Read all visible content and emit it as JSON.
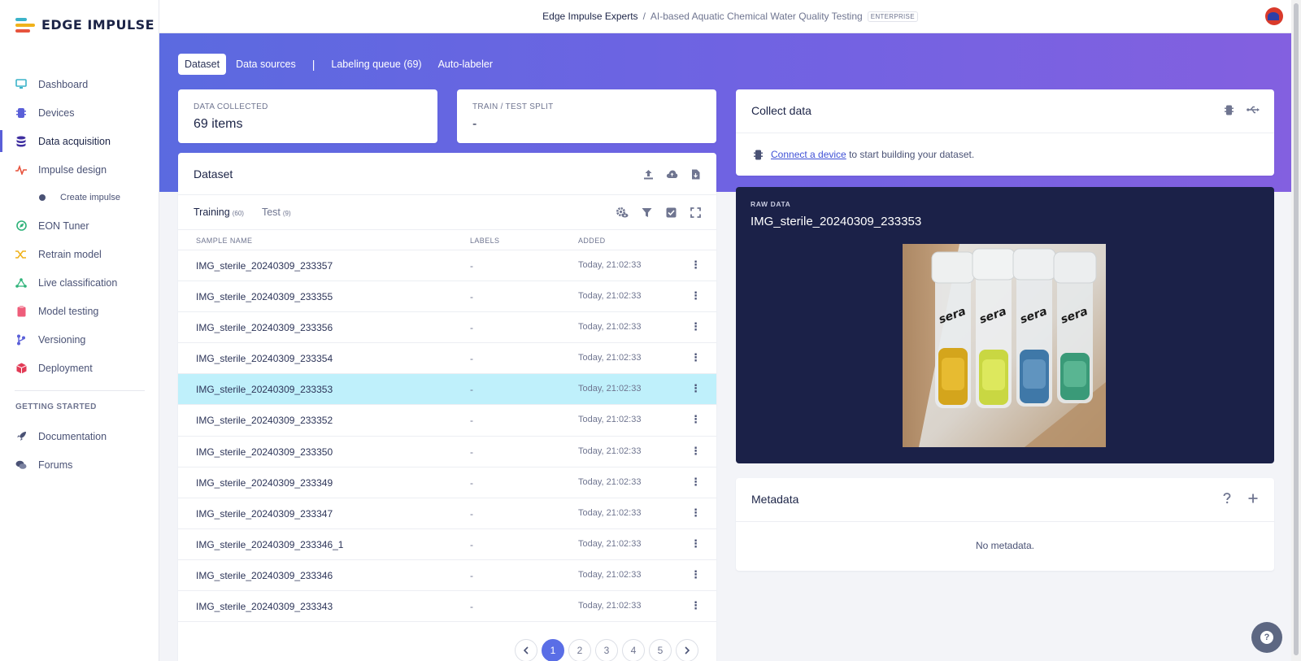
{
  "app": {
    "logo_text": "EDGE IMPULSE"
  },
  "header": {
    "org": "Edge Impulse Experts",
    "separator": "/",
    "project": "AI-based Aquatic Chemical Water Quality Testing",
    "badge": "ENTERPRISE"
  },
  "sidebar": {
    "items": [
      {
        "label": "Dashboard",
        "icon": "monitor-icon",
        "color": "#3bb3c9"
      },
      {
        "label": "Devices",
        "icon": "chip-icon",
        "color": "#5a5fd8"
      },
      {
        "label": "Data acquisition",
        "icon": "database-icon",
        "color": "#3f2fa0"
      },
      {
        "label": "Impulse design",
        "icon": "pulse-icon",
        "color": "#e7533d"
      },
      {
        "label": "Create impulse",
        "icon": "dot-icon",
        "color": "#4a5275"
      },
      {
        "label": "EON Tuner",
        "icon": "compass-icon",
        "color": "#2fb37a"
      },
      {
        "label": "Retrain model",
        "icon": "shuffle-icon",
        "color": "#f0b21b"
      },
      {
        "label": "Live classification",
        "icon": "network-icon",
        "color": "#2fb37a"
      },
      {
        "label": "Model testing",
        "icon": "clipboard-icon",
        "color": "#ee5d7a"
      },
      {
        "label": "Versioning",
        "icon": "branch-icon",
        "color": "#5a5fd8"
      },
      {
        "label": "Deployment",
        "icon": "cube-icon",
        "color": "#e23b56"
      }
    ],
    "getting_started_heading": "GETTING STARTED",
    "help_items": [
      {
        "label": "Documentation",
        "icon": "rocket-icon"
      },
      {
        "label": "Forums",
        "icon": "chat-icon"
      }
    ]
  },
  "tabs": {
    "dataset": "Dataset",
    "data_sources": "Data sources",
    "separator": "|",
    "labeling_queue": "Labeling queue (69)",
    "auto_labeler": "Auto-labeler"
  },
  "stats": {
    "collected_label": "DATA COLLECTED",
    "collected_value": "69 items",
    "split_label": "TRAIN / TEST SPLIT",
    "split_value": "-"
  },
  "dataset": {
    "title": "Dataset",
    "training_label": "Training",
    "training_count": "(60)",
    "test_label": "Test",
    "test_count": "(9)",
    "columns": [
      "SAMPLE NAME",
      "LABELS",
      "ADDED"
    ],
    "rows": [
      {
        "name": "IMG_sterile_20240309_233357",
        "label": "-",
        "added": "Today, 21:02:33"
      },
      {
        "name": "IMG_sterile_20240309_233355",
        "label": "-",
        "added": "Today, 21:02:33"
      },
      {
        "name": "IMG_sterile_20240309_233356",
        "label": "-",
        "added": "Today, 21:02:33"
      },
      {
        "name": "IMG_sterile_20240309_233354",
        "label": "-",
        "added": "Today, 21:02:33"
      },
      {
        "name": "IMG_sterile_20240309_233353",
        "label": "-",
        "added": "Today, 21:02:33"
      },
      {
        "name": "IMG_sterile_20240309_233352",
        "label": "-",
        "added": "Today, 21:02:33"
      },
      {
        "name": "IMG_sterile_20240309_233350",
        "label": "-",
        "added": "Today, 21:02:33"
      },
      {
        "name": "IMG_sterile_20240309_233349",
        "label": "-",
        "added": "Today, 21:02:33"
      },
      {
        "name": "IMG_sterile_20240309_233347",
        "label": "-",
        "added": "Today, 21:02:33"
      },
      {
        "name": "IMG_sterile_20240309_233346_1",
        "label": "-",
        "added": "Today, 21:02:33"
      },
      {
        "name": "IMG_sterile_20240309_233346",
        "label": "-",
        "added": "Today, 21:02:33"
      },
      {
        "name": "IMG_sterile_20240309_233343",
        "label": "-",
        "added": "Today, 21:02:33"
      }
    ],
    "selected_row": 4,
    "pages": [
      "1",
      "2",
      "3",
      "4",
      "5"
    ],
    "current_page": "1"
  },
  "collect": {
    "title": "Collect data",
    "link_text": "Connect a device",
    "trailing_text": " to start building your dataset."
  },
  "raw": {
    "label": "RAW DATA",
    "title": "IMG_sterile_20240309_233353",
    "tube_brand": "sera"
  },
  "metadata": {
    "title": "Metadata",
    "empty_text": "No metadata."
  },
  "colors": {
    "accent": "#5a6ee6",
    "selected_row": "#bff0fb",
    "raw_bg": "#1b2148"
  }
}
